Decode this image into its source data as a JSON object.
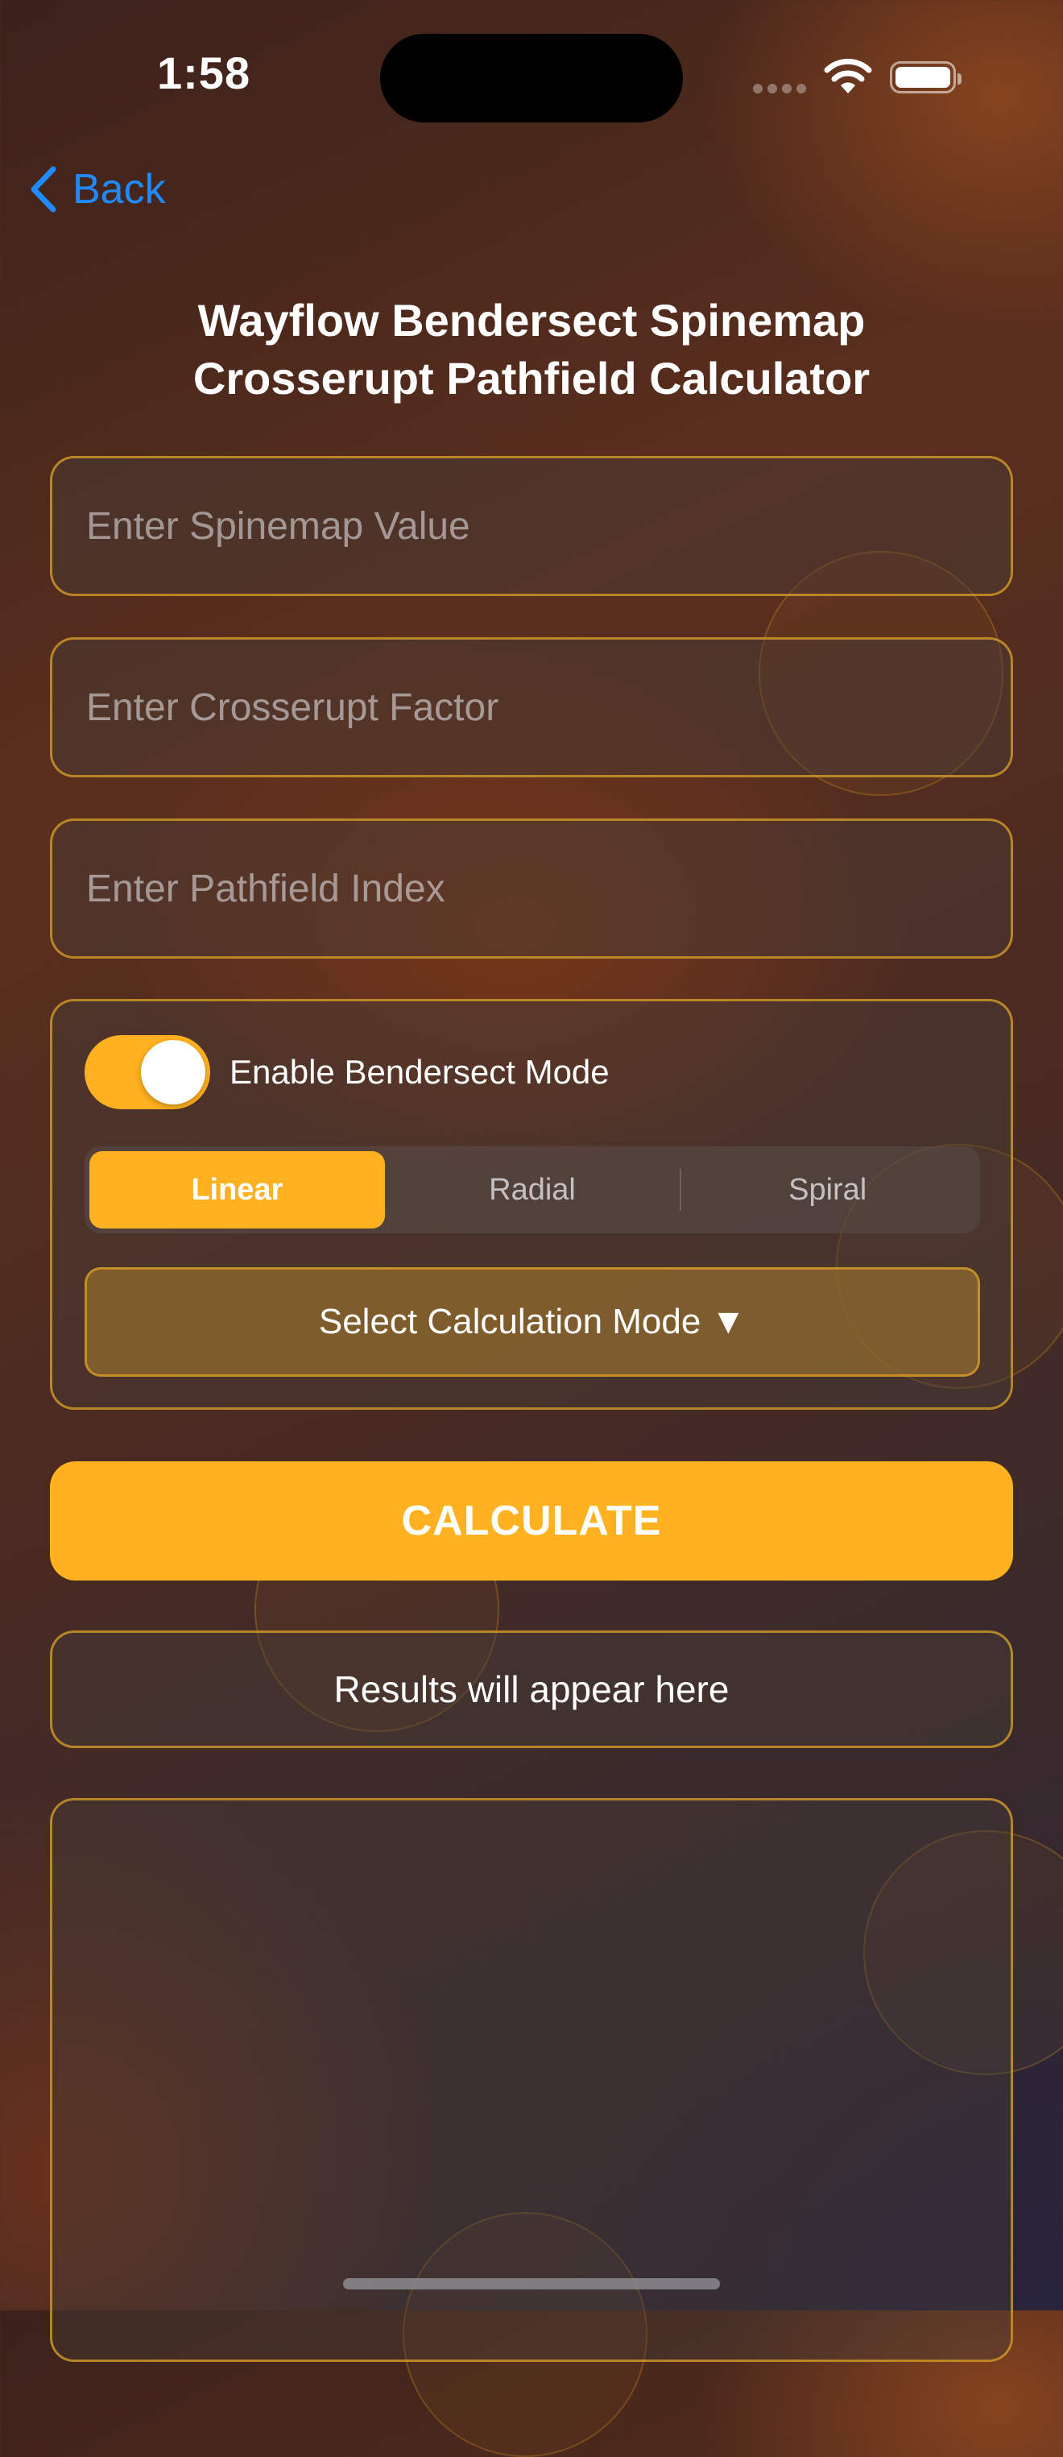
{
  "status_bar": {
    "time": "1:58"
  },
  "nav": {
    "back_label": "Back"
  },
  "page": {
    "title_line1": "Wayflow Bendersect Spinemap",
    "title_line2": "Crosserupt Pathfield Calculator"
  },
  "inputs": {
    "spinemap": {
      "placeholder": "Enter Spinemap Value",
      "value": ""
    },
    "crosserupt": {
      "placeholder": "Enter Crosserupt Factor",
      "value": ""
    },
    "pathfield": {
      "placeholder": "Enter Pathfield Index",
      "value": ""
    }
  },
  "options": {
    "toggle_label": "Enable Bendersect Mode",
    "toggle_on": true,
    "segments": [
      "Linear",
      "Radial",
      "Spiral"
    ],
    "selected_segment": "Linear",
    "mode_select_label": "Select Calculation Mode ▼"
  },
  "actions": {
    "calculate_label": "CALCULATE"
  },
  "results": {
    "text": "Results will appear here"
  },
  "colors": {
    "accent": "#ffb11f",
    "link": "#1f8bff",
    "border": "#cd9428"
  }
}
